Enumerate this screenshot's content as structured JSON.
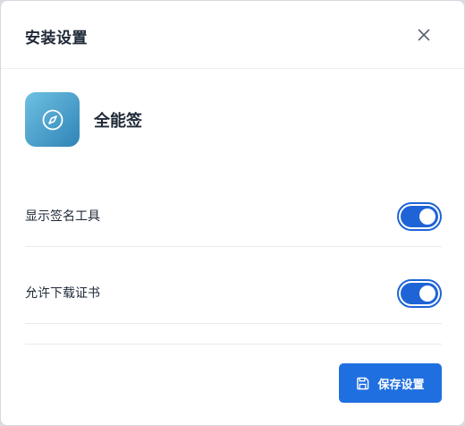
{
  "dialog": {
    "title": "安装设置",
    "close_icon": "close-icon"
  },
  "app": {
    "name": "全能签",
    "icon": "compass-icon",
    "icon_gradient": [
      "#6ec1e2",
      "#2f84b7"
    ]
  },
  "settings": [
    {
      "label": "显示签名工具",
      "enabled": true
    },
    {
      "label": "允许下载证书",
      "enabled": true
    }
  ],
  "footer": {
    "save_label": "保存设置",
    "save_icon": "save-icon"
  },
  "colors": {
    "accent": "#1f6fe0",
    "toggle_on": "#1e64d6"
  }
}
